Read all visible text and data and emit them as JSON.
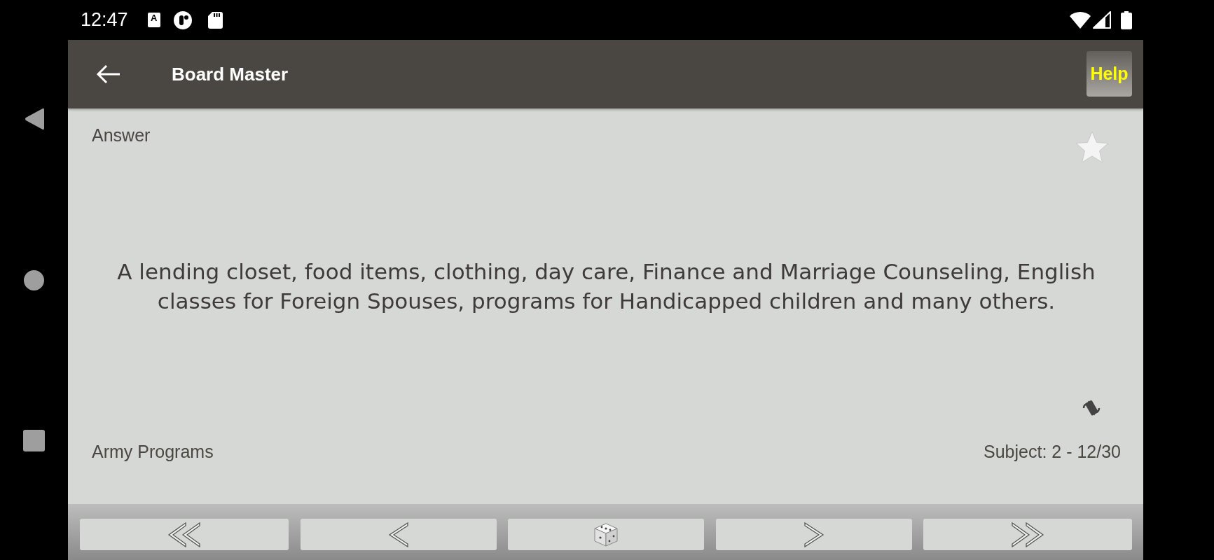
{
  "status_bar": {
    "time": "12:47",
    "notification_letter": "A"
  },
  "toolbar": {
    "title": "Board Master",
    "help_button": "Help"
  },
  "card": {
    "label": "Answer",
    "favorite": false,
    "answer": "A lending closet, food items, clothing, day care, Finance and Marriage Counseling, English classes for Foreign Spouses, programs for Handicapped children and many others.",
    "category": "Army Programs",
    "position": "Subject: 2 - 12/30"
  }
}
